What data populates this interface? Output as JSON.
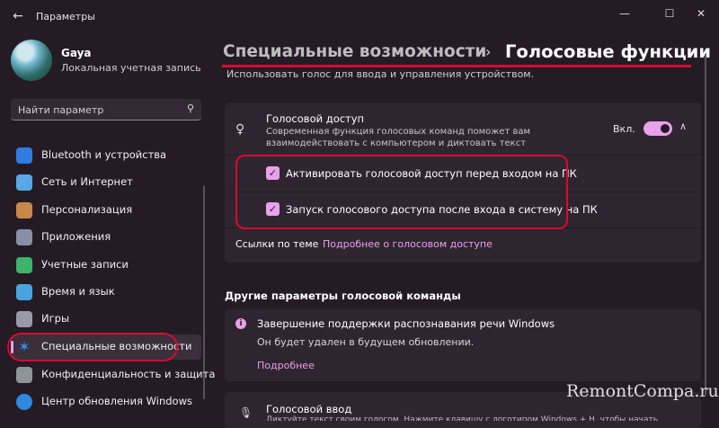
{
  "window": {
    "title": "Параметры",
    "controls": [
      "minimize-icon",
      "maximize-icon",
      "close-icon"
    ]
  },
  "user": {
    "name": "Gaya",
    "account": "Локальная учетная запись"
  },
  "search": {
    "placeholder": "Найти параметр"
  },
  "sidebar": {
    "items": [
      {
        "label": "Bluetooth и устройства",
        "icon": "bluetooth-icon",
        "color": "#2f7de1"
      },
      {
        "label": "Сеть и Интернет",
        "icon": "wifi-icon",
        "color": "#5aa7e8"
      },
      {
        "label": "Персонализация",
        "icon": "brush-icon",
        "color": "#c9884a"
      },
      {
        "label": "Приложения",
        "icon": "apps-icon",
        "color": "#8a8fa8"
      },
      {
        "label": "Учетные записи",
        "icon": "person-icon",
        "color": "#3fb36a"
      },
      {
        "label": "Время и язык",
        "icon": "globe-clock-icon",
        "color": "#4aa3dc"
      },
      {
        "label": "Игры",
        "icon": "gamepad-icon",
        "color": "#9a9aa6"
      },
      {
        "label": "Специальные возможности",
        "icon": "accessibility-icon",
        "color": "#2f8fe8",
        "active": true
      },
      {
        "label": "Конфиденциальность и защита",
        "icon": "shield-icon",
        "color": "#8f949b"
      },
      {
        "label": "Центр обновления Windows",
        "icon": "update-icon",
        "color": "#2f88e0"
      }
    ]
  },
  "header": {
    "breadcrumb_parent": "Специальные возможности",
    "separator": "›",
    "breadcrumb_current": "Голосовые функции",
    "description": "Использовать голос для ввода и управления устройством."
  },
  "voice_access": {
    "title": "Голосовой доступ",
    "description": "Современная функция голосовых команд поможет вам взаимодействовать с компьютером и диктовать текст",
    "toggle_label": "Вкл.",
    "toggle_on": true,
    "options": [
      {
        "label": "Активировать голосовой доступ перед входом на ПК",
        "checked": true
      },
      {
        "label": "Запуск голосового доступа после входа в систему на ПК",
        "checked": true
      }
    ],
    "related_label": "Ссылки по теме",
    "related_link": "Подробнее о голосовом доступе"
  },
  "other": {
    "section_title": "Другие параметры голосовой команды",
    "notice_title": "Завершение поддержки распознавания речи Windows",
    "notice_desc": "Он будет удален в будущем обновлении.",
    "notice_link": "Подробнее"
  },
  "voice_typing": {
    "title": "Голосовой ввод",
    "description": "Диктуйте текст своим голосом. Нажмите клавишу с логотипом Windows + H, чтобы начать"
  },
  "watermark": "RemontCompa.ru",
  "colors": {
    "accent": "#e8a1ea",
    "highlight": "#d50c2f",
    "background": "#241b25",
    "card": "#2f2530"
  }
}
